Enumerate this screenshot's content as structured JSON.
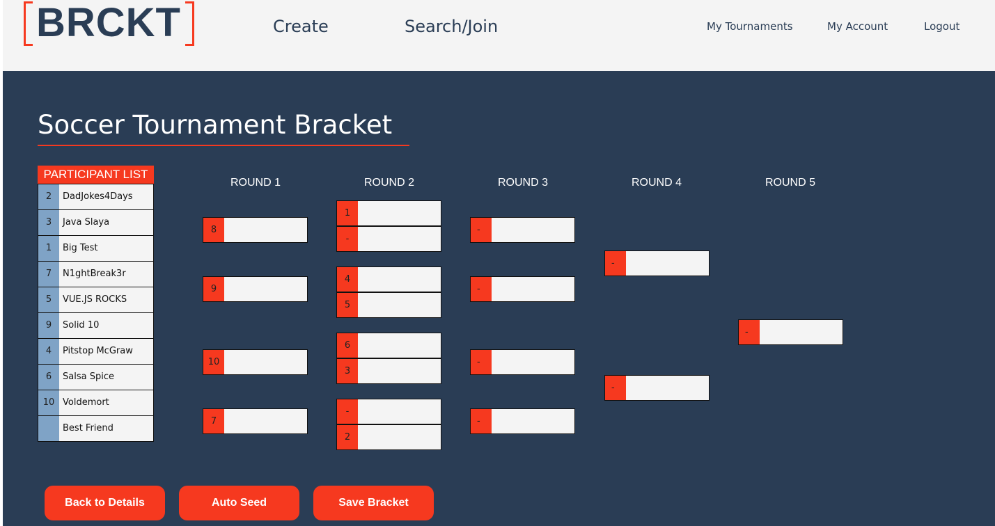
{
  "colors": {
    "accent": "#f6391f",
    "navy": "#2a3d55",
    "nav_bg": "#f4f4f4",
    "seed_blue": "#7fa3c6"
  },
  "logo": {
    "text": "BRCKT"
  },
  "nav": {
    "create": "Create",
    "search_join": "Search/Join",
    "my_tournaments": "My Tournaments",
    "my_account": "My Account",
    "logout": "Logout"
  },
  "page": {
    "title": "Soccer Tournament Bracket"
  },
  "participants": {
    "header": "PARTICIPANT LIST",
    "rows": [
      {
        "seed": "2",
        "name": "DadJokes4Days"
      },
      {
        "seed": "3",
        "name": "Java Slaya"
      },
      {
        "seed": "1",
        "name": "Big Test"
      },
      {
        "seed": "7",
        "name": "N1ghtBreak3r"
      },
      {
        "seed": "5",
        "name": "VUE.JS ROCKS"
      },
      {
        "seed": "9",
        "name": "Solid 10"
      },
      {
        "seed": "4",
        "name": "Pitstop McGraw"
      },
      {
        "seed": "6",
        "name": "Salsa Spice"
      },
      {
        "seed": "10",
        "name": "Voldemort"
      },
      {
        "seed": "",
        "name": "Best Friend"
      }
    ]
  },
  "rounds": {
    "labels": [
      "ROUND 1",
      "ROUND 2",
      "ROUND 3",
      "ROUND 4",
      "ROUND 5"
    ],
    "round1": [
      "8",
      "9",
      "10",
      "7"
    ],
    "round2": [
      "1",
      "-",
      "4",
      "5",
      "6",
      "3",
      "-",
      "2"
    ],
    "round3": [
      "-",
      "-",
      "-",
      "-"
    ],
    "round4": [
      "-",
      "-"
    ],
    "round5": [
      "-"
    ]
  },
  "buttons": {
    "back": "Back to Details",
    "auto_seed": "Auto Seed",
    "save": "Save Bracket"
  }
}
